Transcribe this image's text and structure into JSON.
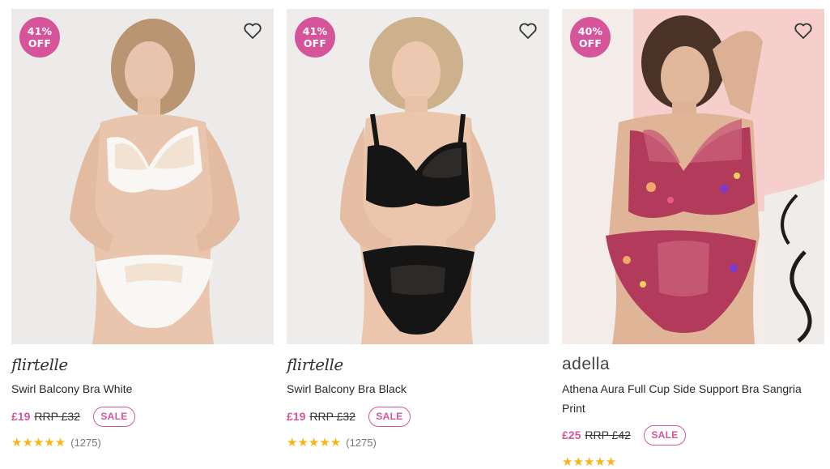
{
  "products": [
    {
      "badge_pct": "41%",
      "badge_off": "OFF",
      "brand": "flirtelle",
      "name": "Swirl Balcony Bra White",
      "price": "£19",
      "rrp": "RRP £32",
      "sale_label": "SALE",
      "stars": "★★★★★",
      "rating_count": "(1275)",
      "image_alt": "model wearing white lace balcony bra and brief"
    },
    {
      "badge_pct": "41%",
      "badge_off": "OFF",
      "brand": "flirtelle",
      "name": "Swirl Balcony Bra Black",
      "price": "£19",
      "rrp": "RRP £32",
      "sale_label": "SALE",
      "stars": "★★★★★",
      "rating_count": "(1275)",
      "image_alt": "model wearing black lace balcony bra and brief"
    },
    {
      "badge_pct": "40%",
      "badge_off": "OFF",
      "brand": "adella",
      "name": "Athena Aura Full Cup Side Support Bra Sangria Print",
      "price": "£25",
      "rrp": "RRP £42",
      "sale_label": "SALE",
      "stars": "★★★★★",
      "image_alt": "model wearing pink floral print full cup bra and brief"
    }
  ],
  "colors": {
    "accent": "#d6559a",
    "star": "#f5b617"
  }
}
